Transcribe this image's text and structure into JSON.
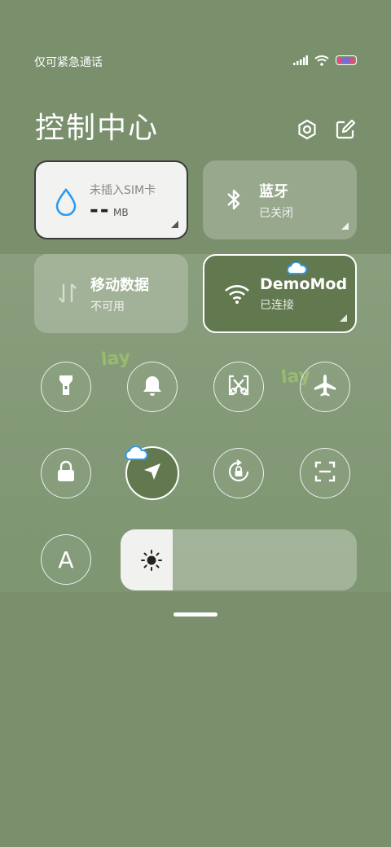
{
  "status_bar": {
    "carrier": "仅可紧急通话"
  },
  "header": {
    "title": "控制中心"
  },
  "tiles": {
    "data_usage": {
      "label": "未插入SIM卡",
      "value": "--",
      "unit": "MB"
    },
    "bluetooth": {
      "label": "蓝牙",
      "status": "已关闭"
    },
    "mobile_data": {
      "label": "移动数据",
      "status": "不可用"
    },
    "wifi": {
      "label": "DemoMod",
      "status": "已连接"
    }
  },
  "toggles": {
    "row1": [
      "flashlight-icon",
      "bell-icon",
      "screenshot-icon",
      "airplane-icon"
    ],
    "row2": [
      "lock-icon",
      "location-icon",
      "rotation-lock-icon",
      "scan-icon"
    ],
    "font_button": "A"
  },
  "brightness": {
    "level": 0.22
  },
  "colors": {
    "background": "#7a906d",
    "active_tile": "#62794f",
    "accent_blue": "#2f9bf0"
  }
}
